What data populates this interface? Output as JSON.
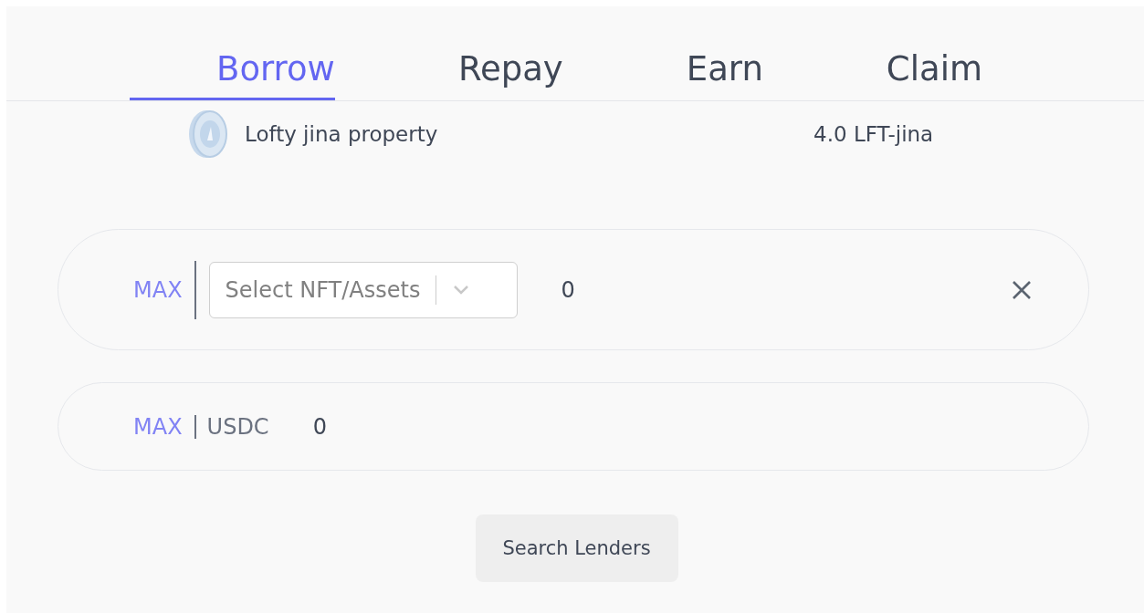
{
  "tabs": [
    {
      "label": "Borrow",
      "selected": true
    },
    {
      "label": "Repay",
      "selected": false
    },
    {
      "label": "Earn",
      "selected": false
    },
    {
      "label": "Claim",
      "selected": false
    }
  ],
  "asset": {
    "name": "Lofty jina property",
    "balance": "4.0 LFT-jina"
  },
  "collateral": {
    "max_label": "MAX",
    "select": {
      "placeholder": "Select NFT/Assets"
    },
    "amount": "0"
  },
  "loan": {
    "max_label": "MAX",
    "currency": "USDC",
    "amount": "0"
  },
  "buttons": [
    "Search Lenders"
  ]
}
